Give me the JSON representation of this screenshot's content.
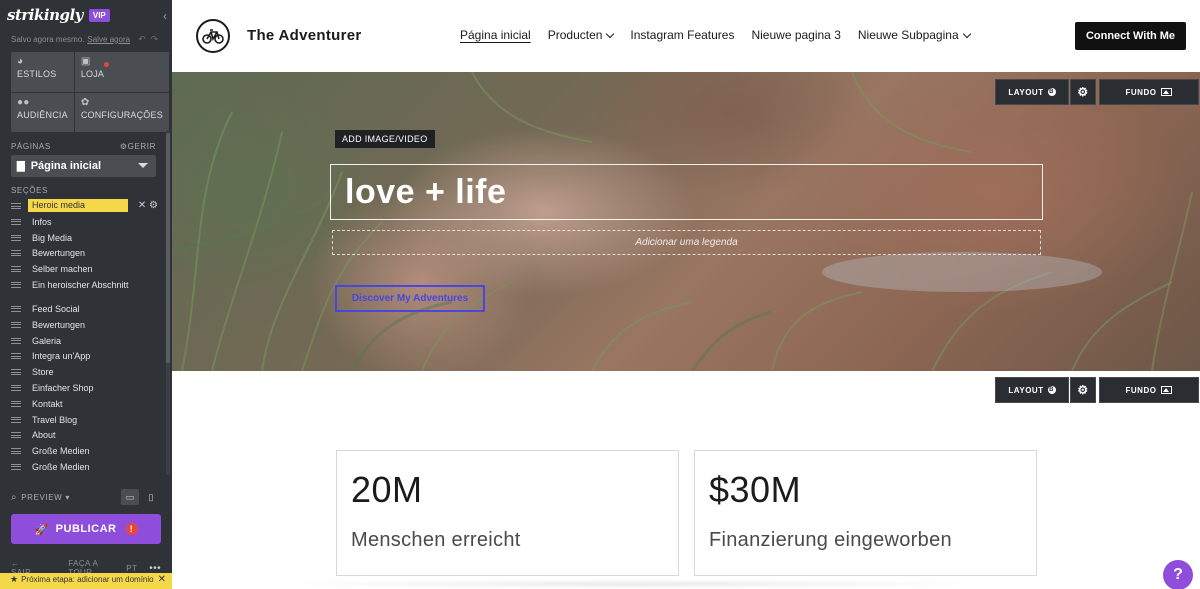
{
  "sidebar": {
    "brand": "strikingly",
    "vip_badge": "VIP",
    "saved_text": "Salvo agora mesmo.",
    "save_link": "Salve agora",
    "menu": [
      {
        "label": "ESTILOS",
        "icon": "palette-icon"
      },
      {
        "label": "LOJA",
        "icon": "lock-icon"
      },
      {
        "label": "AUDIÊNCIA",
        "icon": "people-icon"
      },
      {
        "label": "CONFIGURAÇÕES",
        "icon": "gear-icon"
      }
    ],
    "pages_label": "PÁGINAS",
    "manage_label": "GERIR",
    "current_page": "Página inicial",
    "sections_label": "SEÇÕES",
    "sections": [
      "Heroic media",
      "Infos",
      "Big Media",
      "Bewertungen",
      "Selber machen",
      "Ein heroischer Abschnitt",
      "Feed Social",
      "Bewertungen",
      "Galeria",
      "Integra un'App",
      "Store",
      "Einfacher Shop",
      "Kontakt",
      "Travel Blog",
      "About",
      "Große Medien",
      "Große Medien"
    ],
    "preview_label": "PREVIEW",
    "publish_label": "PUBLICAR",
    "bottom": {
      "exit": "SAIR",
      "tour": "FAÇA A TOUR",
      "lang": "PT"
    },
    "next_step": "Próxima etapa: adicionar um domínio"
  },
  "nav": {
    "site_title": "The Adventurer",
    "links": [
      "Página inicial",
      "Producten",
      "Instagram Features",
      "Nieuwe pagina 3",
      "Nieuwe Subpagina"
    ],
    "cta": "Connect With Me"
  },
  "hero": {
    "add_media": "ADD IMAGE/VIDEO",
    "title": "love + life",
    "caption_placeholder": "Adicionar uma legenda",
    "button": "Discover My Adventures"
  },
  "controls": {
    "layout_label": "LAYOUT",
    "layout_badge": "B",
    "background_label": "FUNDO"
  },
  "stats": [
    {
      "value": "20M",
      "label": "Menschen erreicht"
    },
    {
      "value": "$30M",
      "label": "Finanzierung eingeworben"
    }
  ],
  "help": "?",
  "colors": {
    "accent": "#8e4ddb",
    "sidebar_bg": "#2f3236",
    "highlight": "#f5d84a",
    "button_blue": "#4a46e0"
  }
}
